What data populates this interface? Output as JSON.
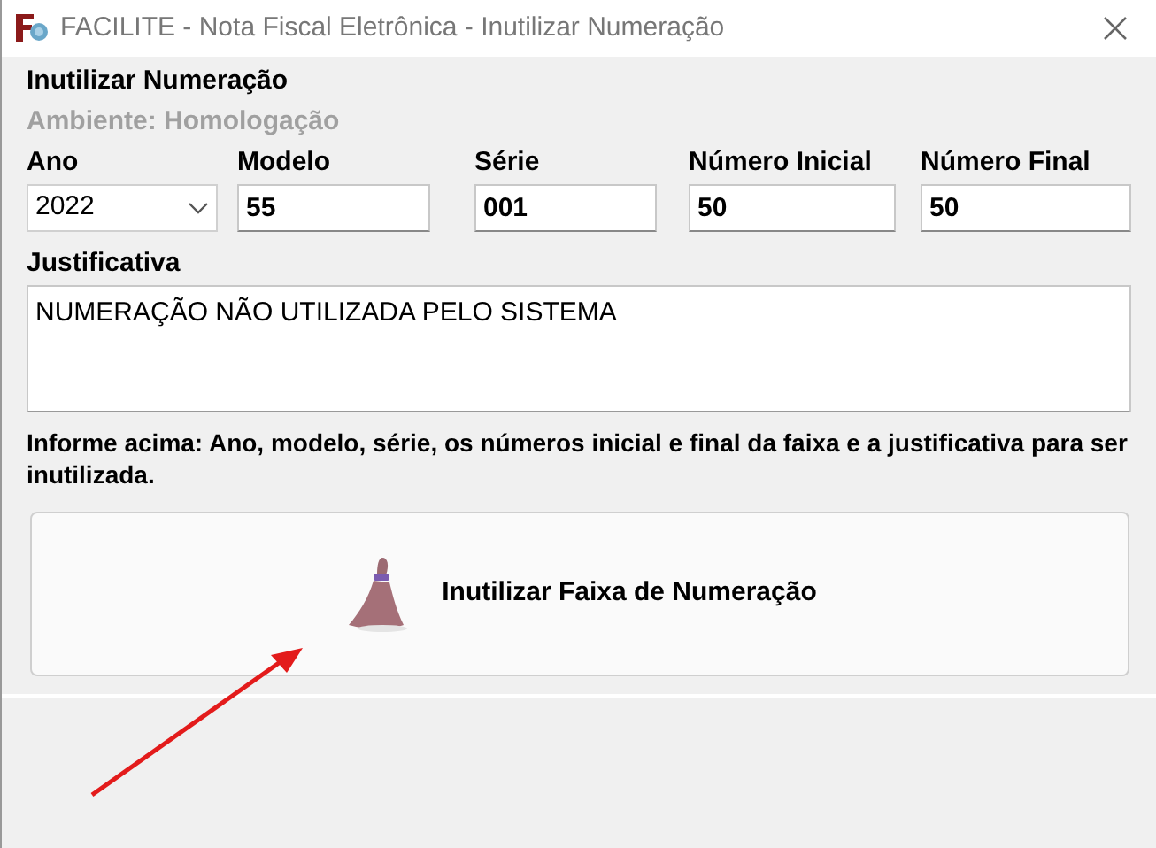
{
  "window": {
    "title": "FACILITE - Nota Fiscal Eletrônica - Inutilizar Numeração"
  },
  "group": {
    "title": "Inutilizar Numeração",
    "environment": "Ambiente: Homologação"
  },
  "fields": [
    {
      "kind": "select",
      "label": "Ano",
      "value": "2022"
    },
    {
      "kind": "text",
      "label": "Modelo",
      "value": "55"
    },
    {
      "kind": "text",
      "label": "Série",
      "value": "001"
    },
    {
      "kind": "text",
      "label": "Número Inicial",
      "value": "50"
    },
    {
      "kind": "text",
      "label": "Número Final",
      "value": "50"
    }
  ],
  "justification": {
    "label": "Justificativa",
    "value": "NUMERAÇÃO NÃO UTILIZADA PELO SISTEMA"
  },
  "hint": "Informe acima: Ano, modelo, série, os números inicial e final da faixa e a justificativa para ser inutilizada.",
  "action_button": "Inutilizar Faixa de Numeração"
}
